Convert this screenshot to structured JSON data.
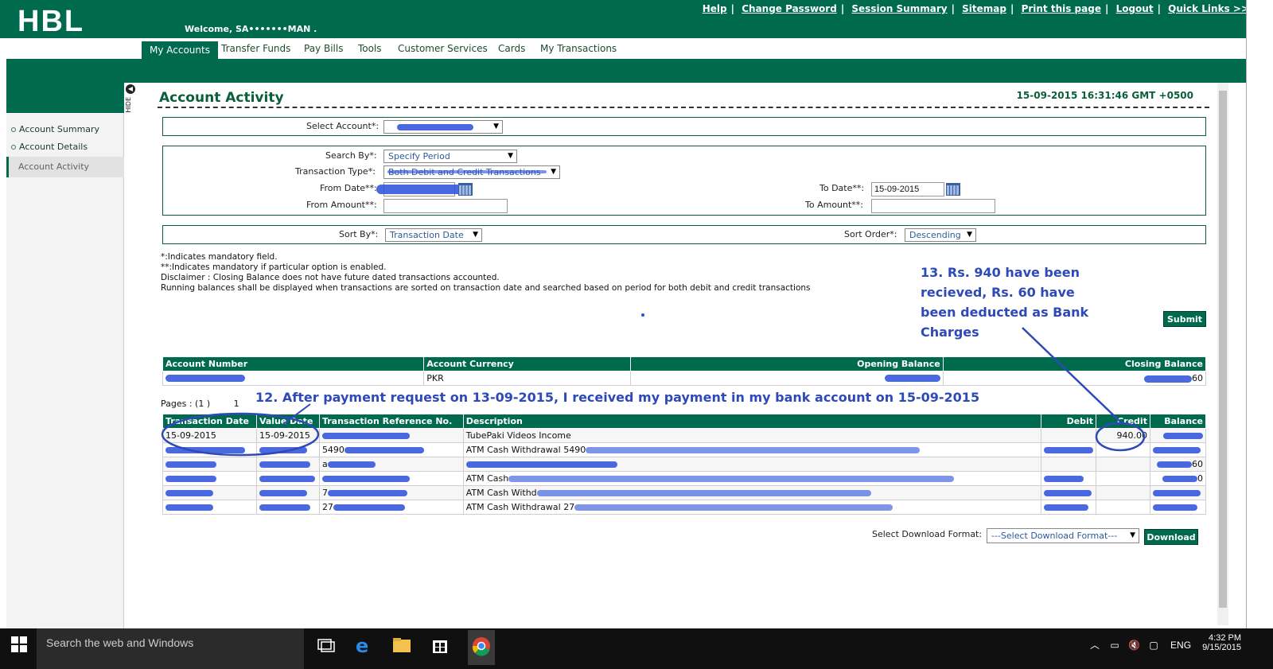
{
  "header": {
    "logo": "HBL",
    "welcome": "Welcome, SA•••••••MAN .",
    "links": [
      "Help",
      "Change Password",
      "Session Summary",
      "Sitemap",
      "Print this page",
      "Logout",
      "Quick Links >>"
    ]
  },
  "nav": {
    "items": [
      "My Accounts",
      "Transfer Funds",
      "Pay Bills",
      "Tools",
      "Customer Services",
      "Cards",
      "My Transactions"
    ]
  },
  "sidebar": {
    "items": [
      "Account Summary",
      "Account Details",
      "Account Activity"
    ],
    "hide_label": "HIDE"
  },
  "page": {
    "title": "Account Activity",
    "timestamp": "15-09-2015 16:31:46 GMT +0500"
  },
  "filters": {
    "select_account_label": "Select Account*:",
    "search_by_label": "Search By*:",
    "search_by_value": "Specify Period",
    "transaction_type_label": "Transaction Type*:",
    "transaction_type_value": "Both Debit and Credit Transactions",
    "from_date_label": "From Date**:",
    "to_date_label": "To Date**:",
    "to_date_value": "15-09-2015",
    "from_amount_label": "From Amount**:",
    "to_amount_label": "To Amount**:",
    "sort_by_label": "Sort By*:",
    "sort_by_value": "Transaction Date",
    "sort_order_label": "Sort Order*:",
    "sort_order_value": "Descending"
  },
  "notes": [
    "*:Indicates mandatory field.",
    "**:Indicates mandatory if particular option is enabled.",
    "Disclaimer : Closing Balance does not have future dated transactions accounted.",
    "Running balances shall be displayed when transactions are sorted on transaction date and searched based on period for both debit and credit transactions"
  ],
  "submit_label": "Submit",
  "summary_table": {
    "headers": [
      "Account Number",
      "Account Currency",
      "Opening Balance",
      "Closing Balance"
    ],
    "row": {
      "currency": "PKR",
      "closing_suffix": "60"
    }
  },
  "pages": {
    "label": "Pages : (1 )",
    "current": "1"
  },
  "annotations": {
    "a12": "12. After payment request on 13-09-2015, I received my payment in my bank account on 15-09-2015",
    "a13_lines": [
      "13. Rs. 940 have been",
      "recieved, Rs. 60 have",
      "been deducted as Bank",
      "Charges"
    ]
  },
  "tx_table": {
    "headers": [
      "Transaction Date",
      "Value Date",
      "Transaction Reference No.",
      "Description",
      "Debit",
      "Credit",
      "Balance"
    ],
    "rows": [
      {
        "tdate": "15-09-2015",
        "vdate": "15-09-2015",
        "ref": "",
        "desc": "TubePaki Videos Income",
        "debit": "",
        "credit": "940.00",
        "bal": ""
      },
      {
        "tdate": "",
        "vdate": "",
        "ref": "5490",
        "desc": "ATM Cash Withdrawal 5490",
        "debit": "",
        "credit": "",
        "bal": ""
      },
      {
        "tdate": "",
        "vdate": "",
        "ref": "a",
        "desc": "",
        "debit": "",
        "credit": "",
        "bal": "60"
      },
      {
        "tdate": "",
        "vdate": "",
        "ref": "",
        "desc": "ATM Cash",
        "debit": "",
        "credit": "",
        "bal": "0"
      },
      {
        "tdate": "",
        "vdate": "",
        "ref": "7",
        "desc": "ATM Cash Withd",
        "debit": "",
        "credit": "",
        "bal": ""
      },
      {
        "tdate": "",
        "vdate": "",
        "ref": "27",
        "desc": "ATM Cash Withdrawal 27",
        "debit": "",
        "credit": "",
        "bal": ""
      }
    ]
  },
  "download": {
    "label": "Select Download Format:",
    "select_value": "---Select Download Format---",
    "button": "Download"
  },
  "taskbar": {
    "search_placeholder": "Search the web and Windows",
    "lang": "ENG",
    "time": "4:32 PM",
    "date": "9/15/2015"
  }
}
